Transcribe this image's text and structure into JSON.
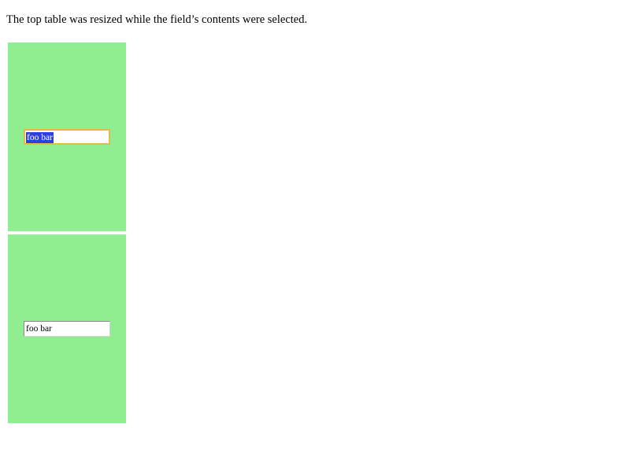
{
  "page": {
    "intro_text": "The top table was resized while the field’s contents were selected."
  },
  "tables": {
    "top": {
      "field_value": "foo bar",
      "field_state": "focused-with-selection"
    },
    "bottom": {
      "field_value": "foo bar",
      "field_state": "unfocused"
    }
  },
  "colors": {
    "cell_background": "#90ee90",
    "focus_ring": "#e8b84a",
    "selection_background": "#3040e0",
    "selection_text": "#ffffff"
  }
}
